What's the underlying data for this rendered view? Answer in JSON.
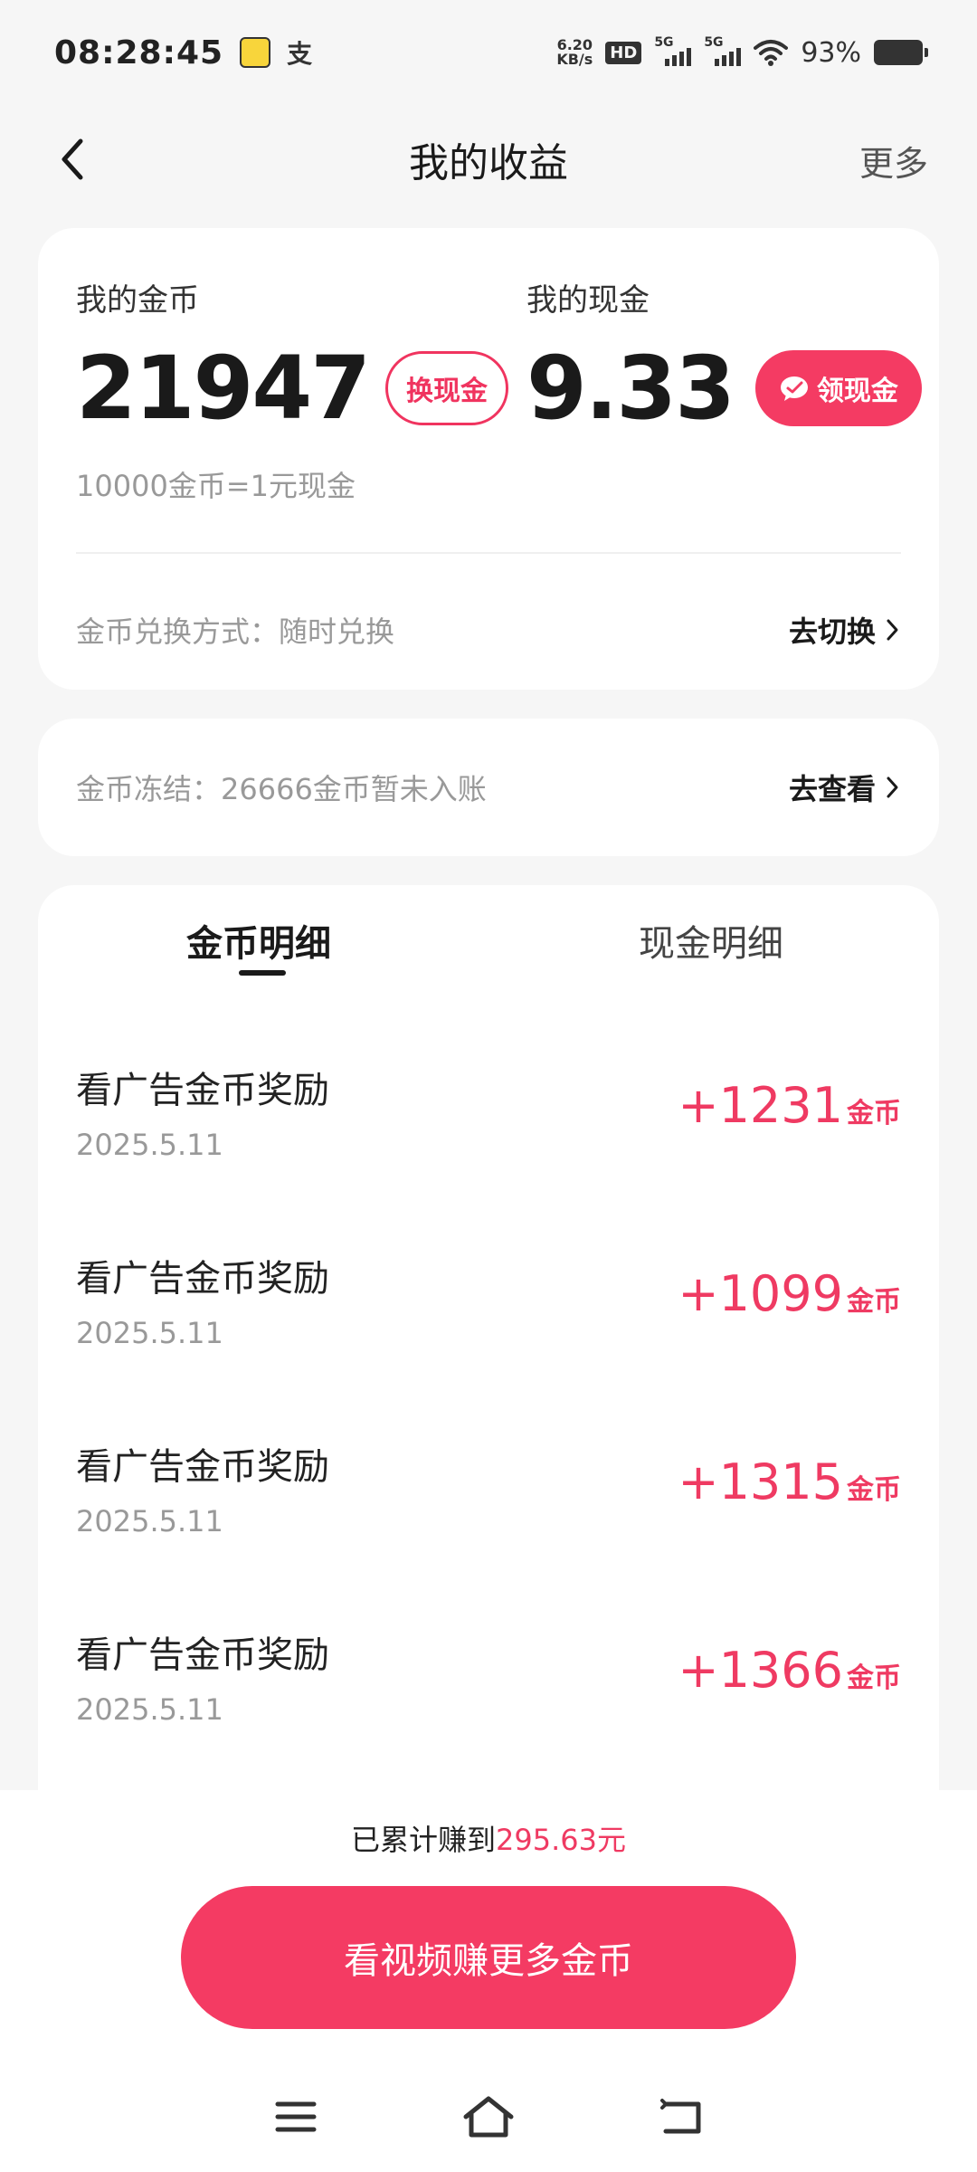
{
  "status_bar": {
    "time": "08:28:45",
    "notif_alipay": "支",
    "net_speed_value": "6.20",
    "net_speed_unit": "KB/s",
    "hd": "HD",
    "signal1": "5G",
    "signal2": "5G",
    "battery": "93%"
  },
  "header": {
    "title": "我的收益",
    "more": "更多"
  },
  "balance": {
    "coins_label": "我的金币",
    "coins_value": "21947",
    "exchange_button": "换现金",
    "cash_label": "我的现金",
    "cash_value": "9.33",
    "withdraw_button": "领现金",
    "rate": "10000金币=1元现金",
    "exchange_mode": "金币兑换方式：随时兑换",
    "switch_action": "去切换"
  },
  "frozen": {
    "text": "金币冻结：26666金币暂未入账",
    "action": "去查看"
  },
  "tabs": {
    "coins": "金币明细",
    "cash": "现金明细"
  },
  "records": [
    {
      "title": "看广告金币奖励",
      "date": "2025.5.11",
      "amount": "+1231",
      "unit": "金币"
    },
    {
      "title": "看广告金币奖励",
      "date": "2025.5.11",
      "amount": "+1099",
      "unit": "金币"
    },
    {
      "title": "看广告金币奖励",
      "date": "2025.5.11",
      "amount": "+1315",
      "unit": "金币"
    },
    {
      "title": "看广告金币奖励",
      "date": "2025.5.11",
      "amount": "+1366",
      "unit": "金币"
    }
  ],
  "footer": {
    "earned_prefix": "已累计赚到",
    "earned_value": "295.63元",
    "cta": "看视频赚更多金币"
  },
  "colors": {
    "accent": "#f43b63",
    "accent_text": "#ef3a62",
    "background": "#f6f6f6"
  }
}
